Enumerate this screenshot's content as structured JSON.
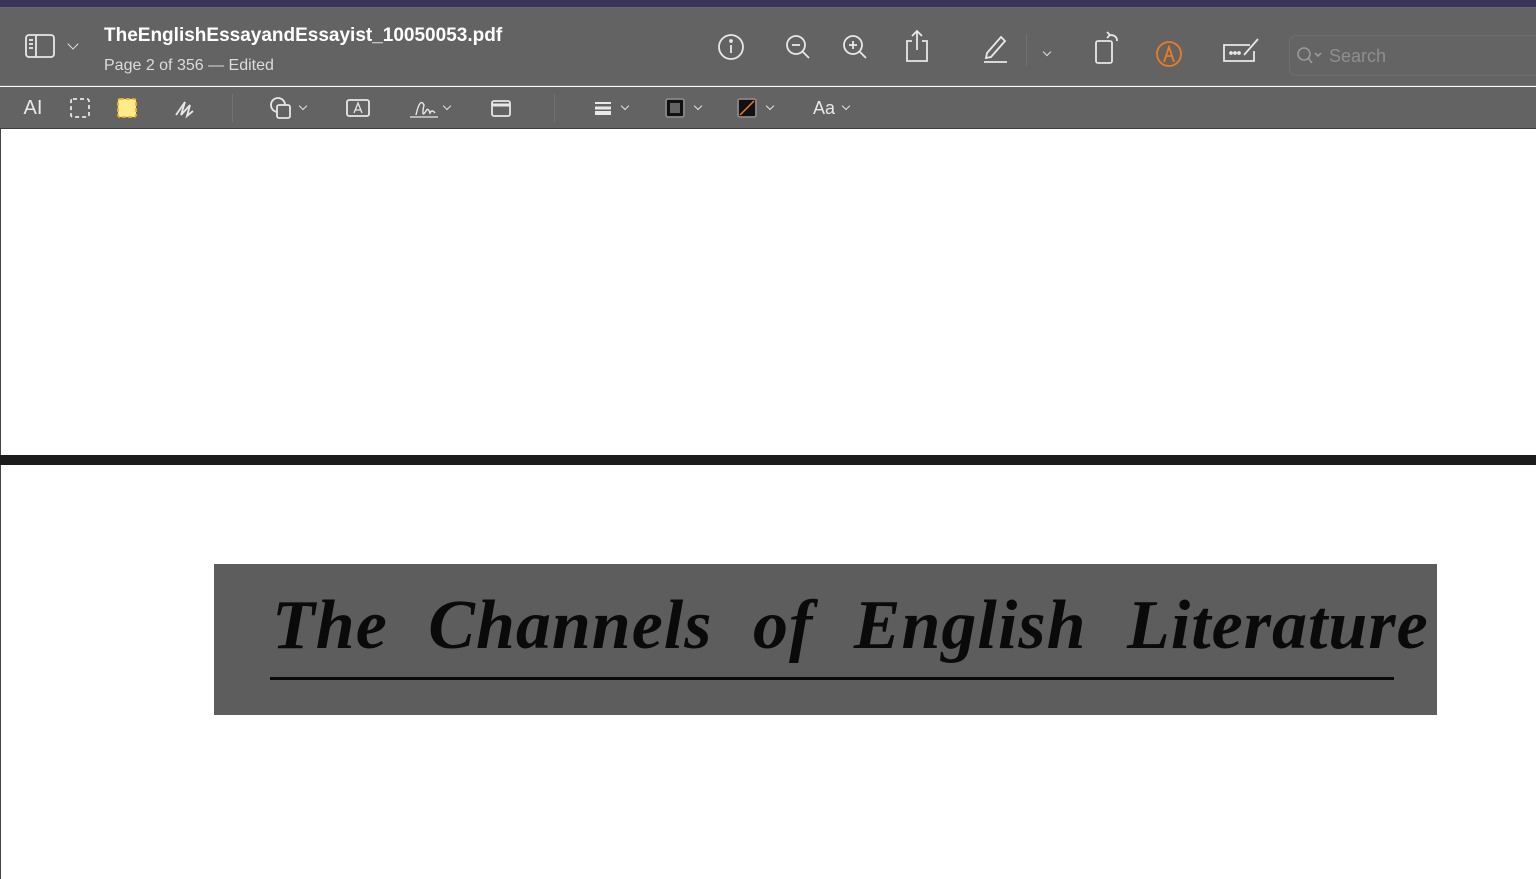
{
  "window": {
    "title": "TheEnglishEssayandEssayist_10050053.pdf",
    "subtitle": "Page 2 of 356 — Edited"
  },
  "toolbar": {
    "search_placeholder": "Search",
    "accent": "#f07c1e"
  },
  "markup_toolbar": {
    "font_label": "Aa"
  },
  "document": {
    "heading": "The Channels of English Literature"
  }
}
